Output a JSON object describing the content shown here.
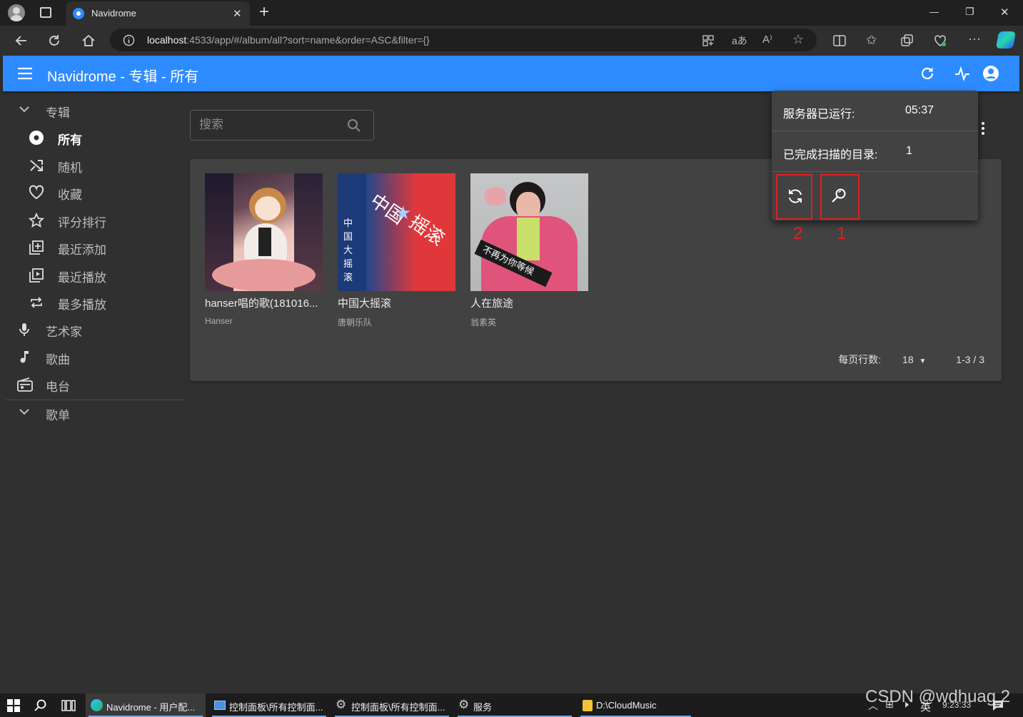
{
  "browser": {
    "tab_title": "Navidrome",
    "new_tab": "+",
    "url_host": "localhost",
    "url_rest": ":4533/app/#/album/all?sort=name&order=ASC&filter={}",
    "window_controls": [
      "—",
      "❐",
      "✕"
    ]
  },
  "appbar": {
    "title": "Navidrome - 专辑 - 所有"
  },
  "sidebar": {
    "albums_section": "专辑",
    "items": [
      {
        "label": "所有",
        "icon": "album-icon"
      },
      {
        "label": "随机",
        "icon": "shuffle-icon"
      },
      {
        "label": "收藏",
        "icon": "heart-icon"
      },
      {
        "label": "评分排行",
        "icon": "star-icon"
      },
      {
        "label": "最近添加",
        "icon": "library-add-icon"
      },
      {
        "label": "最近播放",
        "icon": "video-library-icon"
      },
      {
        "label": "最多播放",
        "icon": "repeat-icon"
      }
    ],
    "artists": "艺术家",
    "songs": "歌曲",
    "radio": "电台",
    "playlists_section": "歌单"
  },
  "search": {
    "placeholder": "搜索"
  },
  "albums": [
    {
      "name": "hanser唱的歌(181016...",
      "artist": "Hanser"
    },
    {
      "name": "中国大摇滚",
      "artist": "唐朝乐队"
    },
    {
      "name": "人在旅途",
      "artist": "翁素英"
    }
  ],
  "pagination": {
    "rows_label": "每页行数:",
    "rows_value": "18",
    "range": "1-3 / 3"
  },
  "activity": {
    "uptime_label": "服务器已运行:",
    "uptime_value": "05:37",
    "scanned_label": "已完成扫描的目录:",
    "scanned_value": "1",
    "annotation_rescan": "2",
    "annotation_quick_scan": "1"
  },
  "taskbar": {
    "items": [
      "Navidrome - 用户配...",
      "控制面板\\所有控制面...",
      "控制面板\\所有控制面...",
      "服务",
      "D:\\CloudMusic"
    ],
    "ime": "英",
    "clock": "9:23:33",
    "watermark": "CSDN @wdhuag 2"
  },
  "colors": {
    "appbar": "#2e8bff",
    "background": "#303030",
    "panel": "#424242",
    "annotation": "#e02020"
  }
}
